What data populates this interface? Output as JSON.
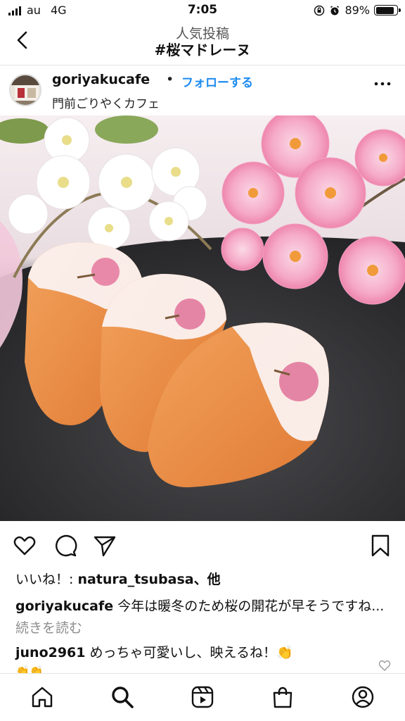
{
  "status_bar": {
    "carrier": "au",
    "network": "4G",
    "time": "7:05",
    "battery": "89%",
    "battery_level": 0.89
  },
  "nav": {
    "subtitle": "人気投稿",
    "title": "#桜マドレーヌ",
    "back_icon": "chevron-left-icon"
  },
  "post": {
    "username": "goriyakucafe",
    "dot": "•",
    "follow_label": "フォローする",
    "location": "門前ごりやくカフェ",
    "more_icon": "more-horizontal-icon"
  },
  "actions": {
    "like_icon": "heart-icon",
    "comment_icon": "comment-icon",
    "share_icon": "send-icon",
    "save_icon": "bookmark-icon"
  },
  "likes": {
    "prefix": "いいね！: ",
    "user": "natura_tsubasa",
    "suffix": "、他"
  },
  "caption": {
    "user": "goriyakucafe",
    "text": " 今年は暖冬のため桜の開花が早そうですね...",
    "more": " 続きを読む"
  },
  "comment": {
    "user": "juno2961",
    "text": " めっちゃ可愛いし、映えるね！👏",
    "text2": "👏👏"
  },
  "tabbar": {
    "items": [
      "home-icon",
      "search-icon",
      "reels-icon",
      "shop-icon",
      "profile-icon"
    ]
  },
  "colors": {
    "link_blue": "#1d8cf0",
    "muted": "#8e8e8e"
  }
}
